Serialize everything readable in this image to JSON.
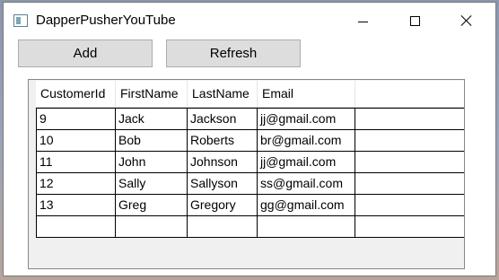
{
  "window": {
    "title": "DapperPusherYouTube"
  },
  "toolbar": {
    "add_label": "Add",
    "refresh_label": "Refresh"
  },
  "grid": {
    "columns": [
      "CustomerId",
      "FirstName",
      "LastName",
      "Email"
    ],
    "rows": [
      [
        "9",
        "Jack",
        "Jackson",
        "jj@gmail.com"
      ],
      [
        "10",
        "Bob",
        "Roberts",
        "br@gmail.com"
      ],
      [
        "11",
        "John",
        "Johnson",
        "jj@gmail.com"
      ],
      [
        "12",
        "Sally",
        "Sallyson",
        "ss@gmail.com"
      ],
      [
        "13",
        "Greg",
        "Gregory",
        "gg@gmail.com"
      ],
      [
        "",
        "",
        "",
        ""
      ]
    ]
  },
  "icons": {
    "app": "window-app-icon",
    "minimize": "minimize-icon",
    "maximize": "maximize-icon",
    "close": "close-icon"
  }
}
